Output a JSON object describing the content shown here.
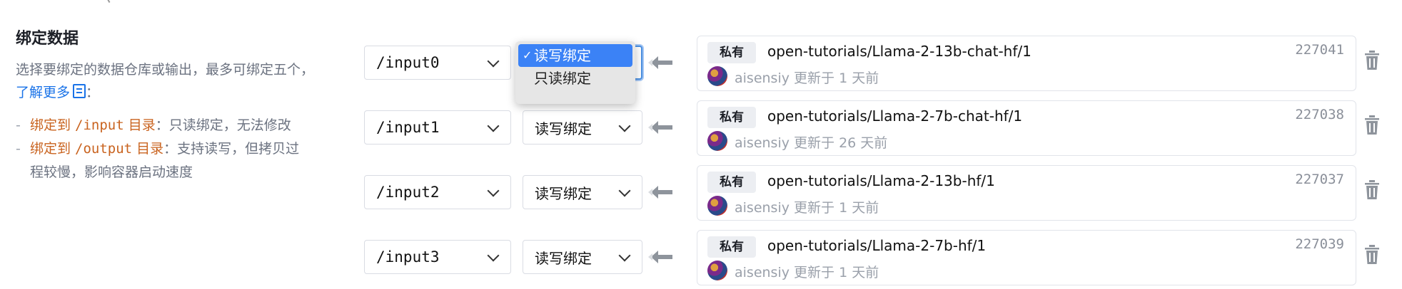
{
  "section": {
    "title": "绑定数据",
    "desc_line1": "选择要绑定的数据仓库或输出，最多可绑定五个，",
    "learn_more": "了解更多",
    "colon": "：",
    "rules": [
      {
        "prefix": "绑定到 ",
        "path": "/input",
        "suffix": " 目录",
        "detail": "：只读绑定，无法修改"
      },
      {
        "prefix": "绑定到 ",
        "path": "/output",
        "suffix": " 目录",
        "detail": "：支持读写，但拷贝过"
      }
    ],
    "rule2_cont": "程较慢，影响容器启动速度"
  },
  "bindings": [
    {
      "path": "/input0",
      "mode": "读写绑定",
      "badge": "私有",
      "repo": "open-tutorials/Llama-2-13b-chat-hf/1",
      "count": "227041",
      "author": "aisensiy",
      "updated": "更新于 1 天前"
    },
    {
      "path": "/input1",
      "mode": "读写绑定",
      "badge": "私有",
      "repo": "open-tutorials/Llama-2-7b-chat-hf/1",
      "count": "227038",
      "author": "aisensiy",
      "updated": "更新于 26 天前"
    },
    {
      "path": "/input2",
      "mode": "读写绑定",
      "badge": "私有",
      "repo": "open-tutorials/Llama-2-13b-hf/1",
      "count": "227037",
      "author": "aisensiy",
      "updated": "更新于 1 天前"
    },
    {
      "path": "/input3",
      "mode": "读写绑定",
      "badge": "私有",
      "repo": "open-tutorials/Llama-2-7b-hf/1",
      "count": "227039",
      "author": "aisensiy",
      "updated": "更新于 1 天前"
    }
  ],
  "dropdown": {
    "options": [
      "读写绑定",
      "只读绑定"
    ],
    "check": "✓",
    "selected": "读写绑定"
  },
  "icons": [
    "arrow-left-icon",
    "trash-icon",
    "chevron-down-icon",
    "doc-icon",
    "check-icon"
  ],
  "colors": {
    "accent": "#1a73e8",
    "highlight": "#c9631f",
    "selected": "#3b82f6"
  }
}
